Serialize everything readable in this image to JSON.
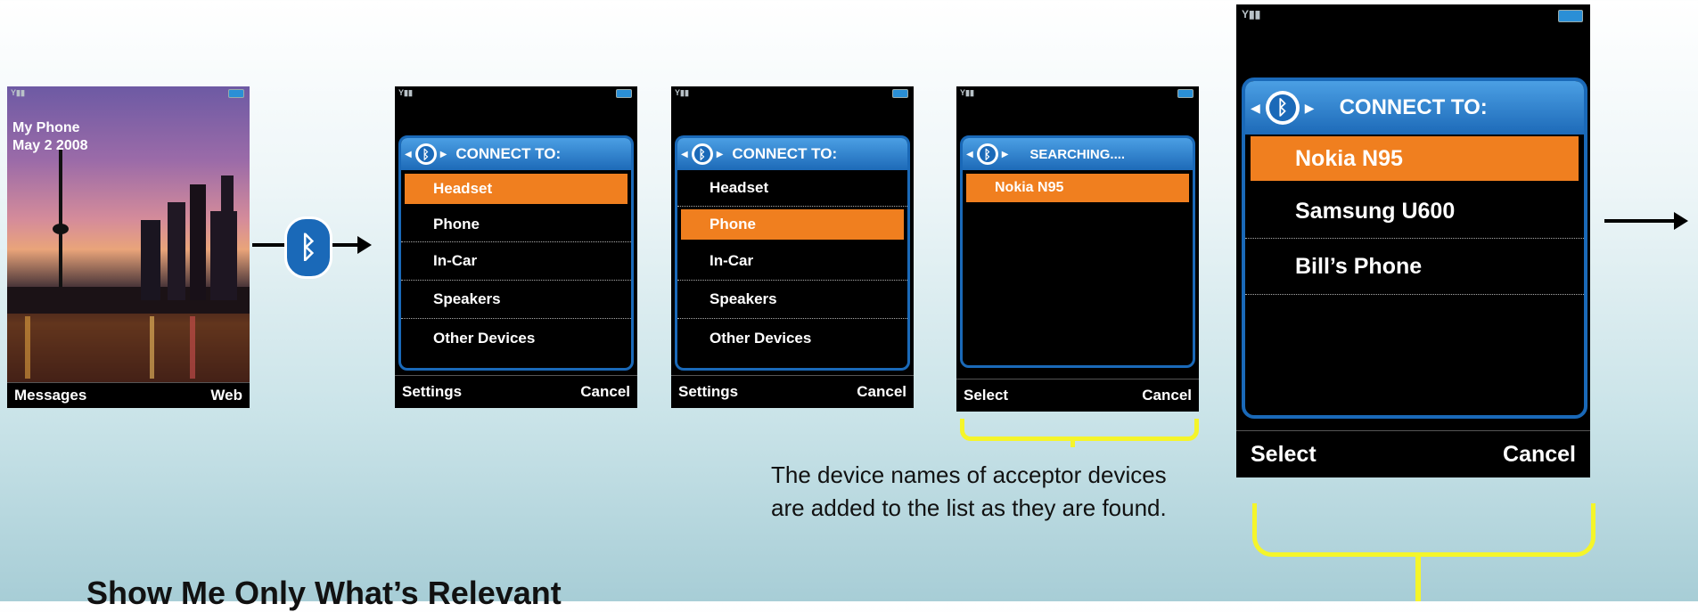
{
  "home": {
    "owner": "My Phone",
    "date": "May 2 2008",
    "left_soft": "Messages",
    "right_soft": "Web"
  },
  "screens": [
    {
      "title": "CONNECT TO:",
      "items": [
        "Headset",
        "Phone",
        "In-Car",
        "Speakers",
        "Other Devices"
      ],
      "selected_index": 0,
      "left_soft": "Settings",
      "right_soft": "Cancel"
    },
    {
      "title": "CONNECT TO:",
      "items": [
        "Headset",
        "Phone",
        "In-Car",
        "Speakers",
        "Other Devices"
      ],
      "selected_index": 1,
      "left_soft": "Settings",
      "right_soft": "Cancel"
    },
    {
      "title": "SEARCHING....",
      "items": [
        "Nokia N95"
      ],
      "selected_index": 0,
      "left_soft": "Select",
      "right_soft": "Cancel"
    },
    {
      "title": "CONNECT TO:",
      "items": [
        "Nokia N95",
        "Samsung U600",
        "Bill’s Phone"
      ],
      "selected_index": 0,
      "left_soft": "Select",
      "right_soft": "Cancel"
    }
  ],
  "note_text": "The device names of acceptor devices are added to the list as they are found.",
  "heading": "Show Me Only What’s Relevant",
  "icons": {
    "bluetooth": "bluetooth-icon",
    "signal": "signal-icon",
    "battery": "battery-icon",
    "arrow": "right-arrow-icon"
  },
  "colors": {
    "accent": "#1a69b8",
    "selection": "#f07f1f",
    "brace": "#f5f52a"
  }
}
